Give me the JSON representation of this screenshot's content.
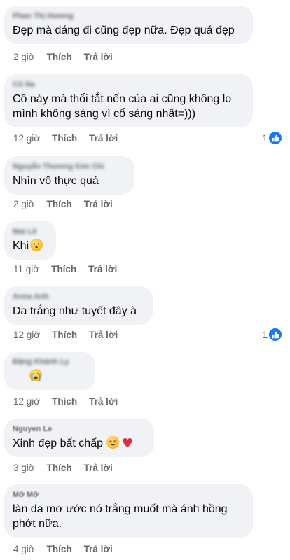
{
  "comments": [
    {
      "author": "Phan Thị Hương",
      "text": "Đẹp mà dáng đi cũng đẹp nữa. Đẹp quá đẹp",
      "time": "2 giờ",
      "like": "Thích",
      "reply": "Trả lời"
    },
    {
      "author": "Cô Na",
      "text": "Cô này mà thổi tắt nến của ai cũng không lo mình không sáng vì cổ sáng nhất=)))",
      "time": "12 giờ",
      "like": "Thích",
      "reply": "Trả lời",
      "reactions": "1"
    },
    {
      "author": "Nguyễn Thương Kim Chi",
      "text": "Nhìn vô thực quá",
      "time": "2 giờ",
      "like": "Thích",
      "reply": "Trả lời"
    },
    {
      "author": "Mai Lê",
      "text": "Khi",
      "time": "11 giờ",
      "like": "Thích",
      "reply": "Trả lời"
    },
    {
      "author": "Anna Anh",
      "text": "Da trắng như tuyết đây à",
      "time": "12 giờ",
      "like": "Thích",
      "reply": "Trả lời",
      "reactions": "1"
    },
    {
      "author": "Đặng Khánh Ly",
      "text": "",
      "time": "12 giờ",
      "like": "Thích",
      "reply": "Trả lời"
    },
    {
      "author": "Nguyen Le",
      "text": "Xinh đẹp bất chấp",
      "time": "3 giờ",
      "like": "Thích",
      "reply": "Trả lời"
    },
    {
      "author": "Mỡ Mỡ",
      "text": "làn da mơ ước nó trắng muốt mà ánh hồng phớt nữa.",
      "time": "4 giờ",
      "like": "Thích",
      "reply": "Trả lời"
    }
  ],
  "icons": {
    "like": "like-icon",
    "emoji_hushed": "hushed-face-emoji",
    "emoji_crying": "crying-face-emoji",
    "emoji_starstruck": "star-struck-emoji",
    "emoji_heart": "red-heart-emoji"
  },
  "colors": {
    "bubble": "#f0f2f5",
    "meta": "#65676b",
    "like_blue": "#1877f2"
  }
}
